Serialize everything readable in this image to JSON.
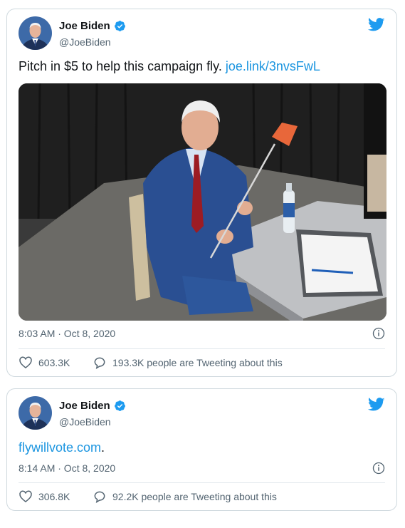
{
  "tweets": [
    {
      "author": {
        "name": "Joe Biden",
        "handle": "@JoeBiden"
      },
      "text": "Pitch in $5 to help this campaign fly. ",
      "link": "joe.link/3nvsFwL",
      "timestamp": "8:03 AM · Oct 8, 2020",
      "likes": "603.3K",
      "tweeting": "193.3K people are Tweeting about this"
    },
    {
      "author": {
        "name": "Joe Biden",
        "handle": "@JoeBiden"
      },
      "text": "",
      "link": "flywillvote.com",
      "trailing": ".",
      "timestamp": "8:14 AM · Oct 8, 2020",
      "likes": "306.8K",
      "tweeting": "92.2K people are Tweeting about this"
    }
  ],
  "colors": {
    "link": "#1b95e0",
    "verified": "#1d9bf0",
    "twitter_blue": "#1d9bf0"
  },
  "icons": [
    "verified-badge-icon",
    "twitter-bird-icon",
    "info-icon",
    "heart-icon",
    "speech-bubble-icon"
  ]
}
